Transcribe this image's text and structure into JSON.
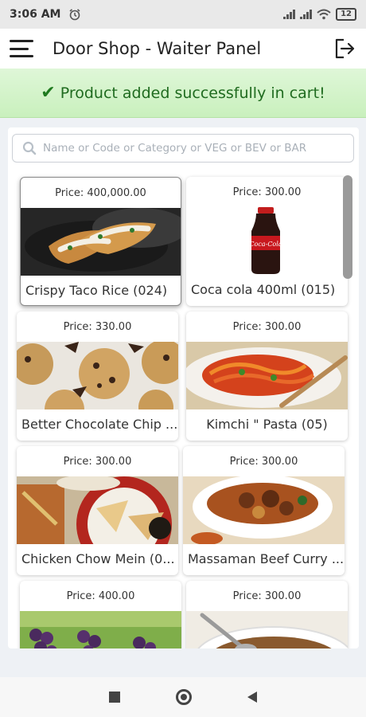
{
  "status_bar": {
    "time": "3:06 AM",
    "battery": "12"
  },
  "app_bar": {
    "title": "Door Shop - Waiter Panel"
  },
  "toast": {
    "message": "Product added successfully in cart!"
  },
  "search": {
    "placeholder": "Name or Code or Category or VEG or BEV or BAR",
    "value": ""
  },
  "products": [
    {
      "price": "Price: 400,000.00",
      "name": "Crispy Taco Rice (024)",
      "image": "crispy-taco-photo"
    },
    {
      "price": "Price: 300.00",
      "name": "Coca cola 400ml (015)",
      "image": "coca-cola-bottle-photo"
    },
    {
      "price": "Price: 330.00",
      "name": "Better Chocolate Chip ...",
      "image": "chocolate-chip-cookies-photo"
    },
    {
      "price": "Price: 300.00",
      "name": "Kimchi \" Pasta (05)",
      "image": "kimchi-pasta-photo"
    },
    {
      "price": "Price: 300.00",
      "name": "Chicken Chow Mein (0...",
      "image": "chicken-chow-mein-photo"
    },
    {
      "price": "Price: 300.00",
      "name": "Massaman Beef Curry ...",
      "image": "massaman-beef-curry-photo"
    },
    {
      "price": "Price: 400.00",
      "name": "",
      "image": "grapes-photo"
    },
    {
      "price": "Price: 300.00",
      "name": "",
      "image": "soup-photo"
    }
  ],
  "colors": {
    "toast_bg": "#d4f4c9",
    "toast_text": "#1f6b1f",
    "app_bar": "#ffffff",
    "background": "#eef1f5"
  },
  "icons": {
    "menu": "hamburger-menu-icon",
    "logout": "logout-icon",
    "search": "search-icon",
    "check": "check-icon"
  }
}
